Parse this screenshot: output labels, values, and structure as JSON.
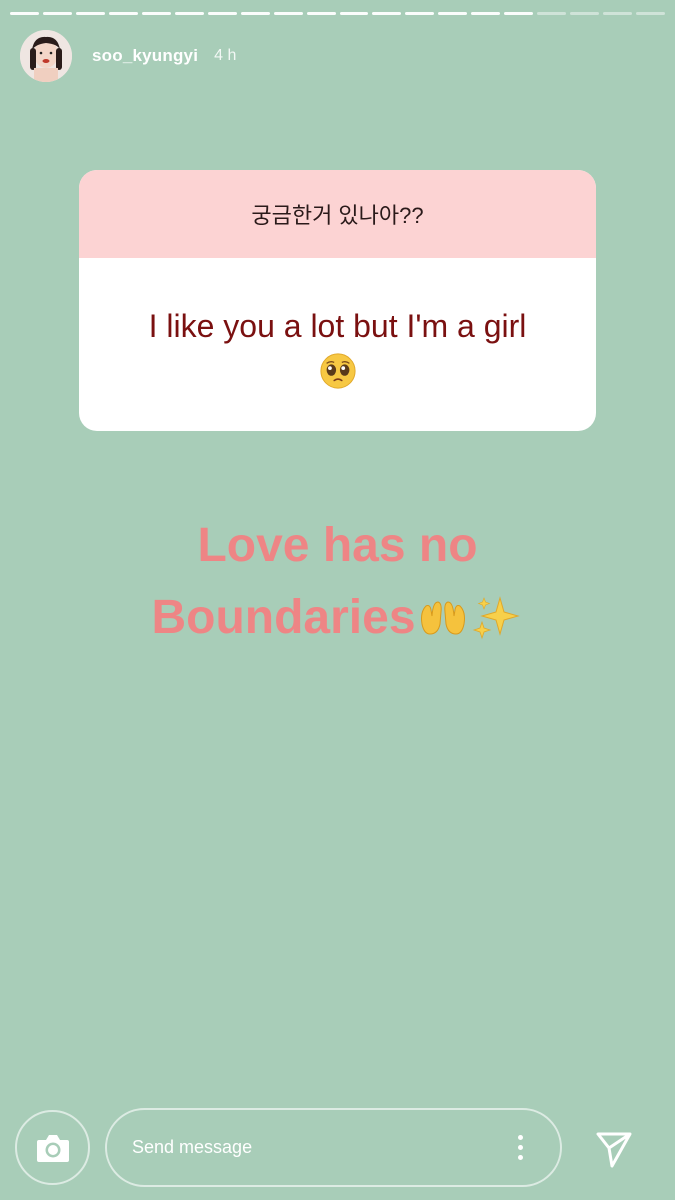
{
  "story": {
    "progress_total": 20,
    "progress_done": 16
  },
  "header": {
    "username": "soo_kyungyi",
    "time": "4 h"
  },
  "question_sticker": {
    "question": "궁금한거 있나아??",
    "answer": "I like you a lot but I'm a girl",
    "answer_emoji": "pleading-face-icon"
  },
  "caption": {
    "line1": "Love has no",
    "line2": "Boundaries",
    "emojis": [
      "open-hands-icon",
      "sparkles-icon"
    ]
  },
  "footer": {
    "message_placeholder": "Send message"
  },
  "colors": {
    "background": "#a8cdb8",
    "sticker_header": "#fcd3d3",
    "answer_text": "#7a1010",
    "caption_text": "#ee8585"
  }
}
